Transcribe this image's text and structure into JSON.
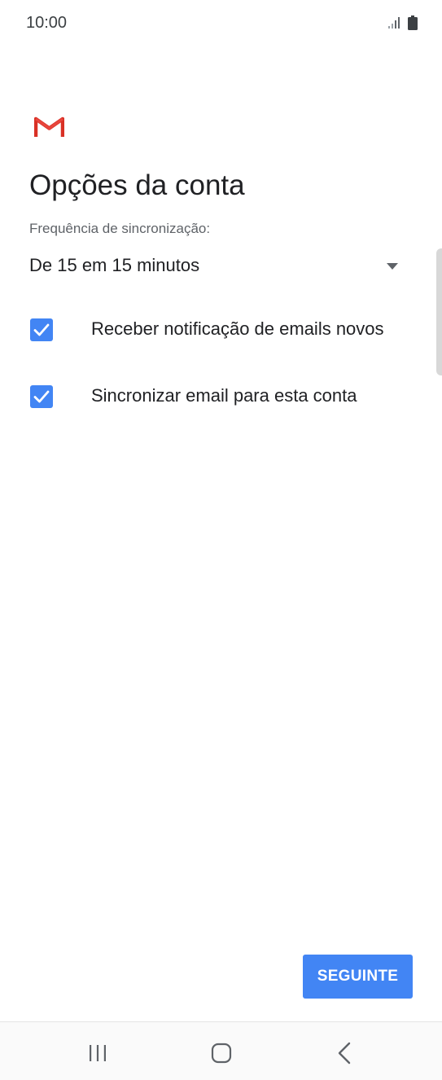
{
  "status_bar": {
    "time": "10:00",
    "icons": [
      "signal-icon",
      "battery-icon"
    ]
  },
  "app": {
    "logo": "gmail-logo",
    "colors": {
      "accent": "#4285f4",
      "gmail_red": "#d93025"
    }
  },
  "page": {
    "title": "Opções da conta"
  },
  "sync": {
    "label": "Frequência de sincronização:",
    "selected": "De 15 em 15 minutos",
    "icon": "dropdown-arrow-icon"
  },
  "options": [
    {
      "label": "Receber notificação de emails novos",
      "checked": true
    },
    {
      "label": "Sincronizar email para esta conta",
      "checked": true
    }
  ],
  "actions": {
    "next_label": "SEGUINTE"
  },
  "nav_bar": {
    "icons": [
      "recent-apps-icon",
      "home-icon",
      "back-icon"
    ]
  }
}
